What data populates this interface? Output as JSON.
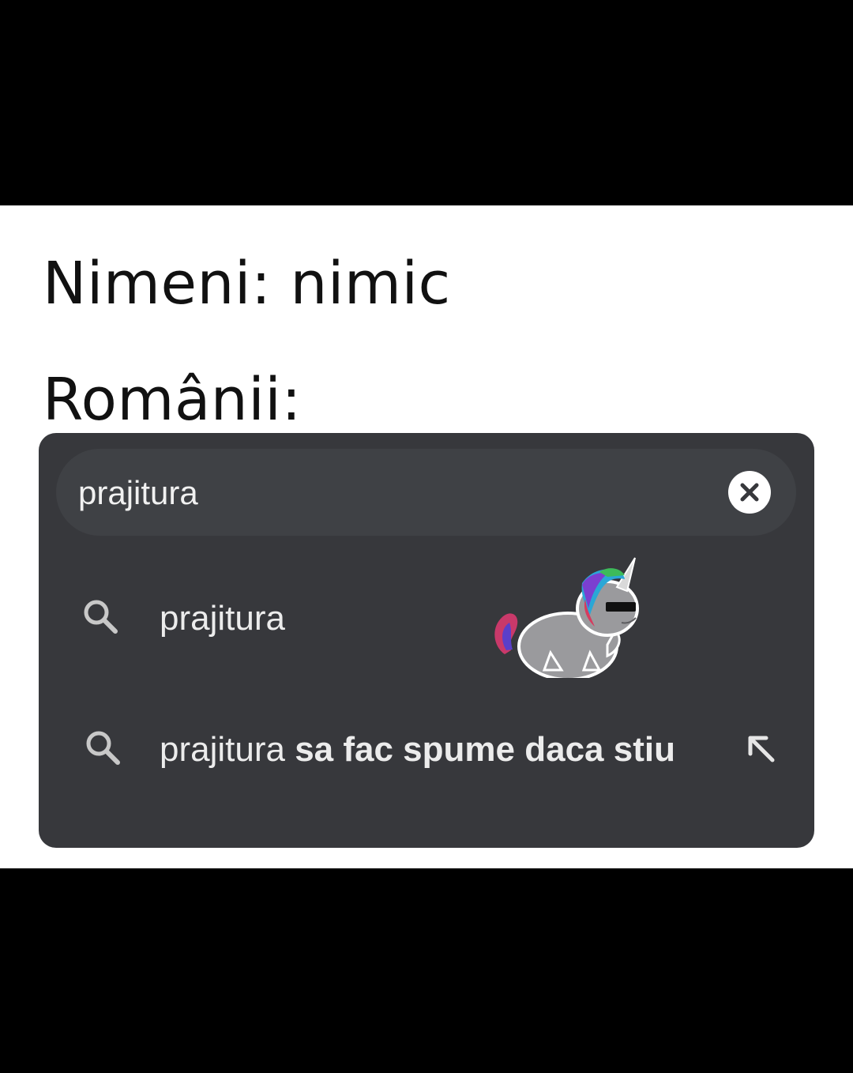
{
  "caption": {
    "line1": "Nimeni: nimic",
    "line2": "Românii:"
  },
  "search": {
    "query": "prajitura",
    "clear_icon": "close-circle-icon"
  },
  "suggestions": [
    {
      "icon": "search-icon",
      "prefix": "prajitura",
      "completion": ""
    },
    {
      "icon": "search-icon",
      "prefix": "prajitura",
      "completion": " sa fac spume daca stiu",
      "action_icon": "arrow-up-left-icon"
    }
  ],
  "sticker": {
    "name": "unicorn-sunglasses-sticker"
  },
  "colors": {
    "card": "#37383c",
    "search_bar": "#3f4145",
    "text": "#ececec",
    "background": "#000000"
  }
}
